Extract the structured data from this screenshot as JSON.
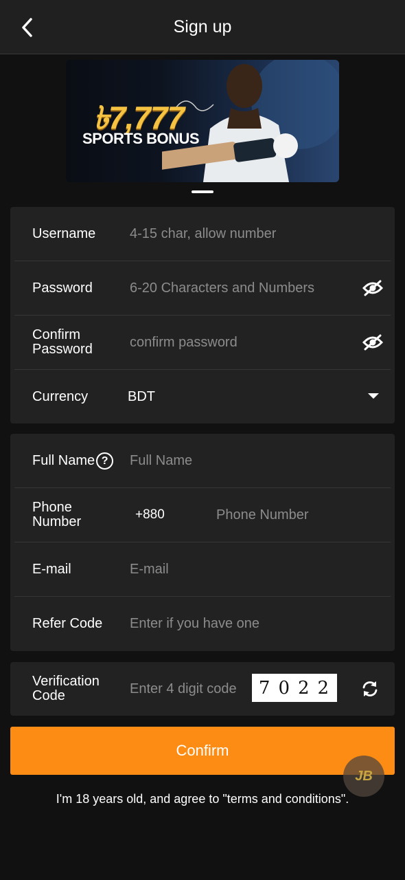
{
  "header": {
    "title": "Sign up",
    "back_icon": "chevron-left-icon"
  },
  "banner": {
    "amount": "৳7,777",
    "subtitle": "SPORTS BONUS",
    "colors": {
      "amount": "#f5c242"
    }
  },
  "account_form": {
    "username": {
      "label": "Username",
      "placeholder": "4-15 char, allow number"
    },
    "password": {
      "label": "Password",
      "placeholder": "6-20 Characters and Numbers",
      "toggle_icon": "eye-off-icon"
    },
    "confirm_password": {
      "label_line1": "Confirm",
      "label_line2": "Password",
      "placeholder": "confirm password",
      "toggle_icon": "eye-off-icon"
    },
    "currency": {
      "label": "Currency",
      "value": "BDT",
      "dropdown_icon": "caret-down-icon"
    }
  },
  "profile_form": {
    "full_name": {
      "label": "Full Name",
      "help_icon": "?",
      "placeholder": "Full Name"
    },
    "phone": {
      "label_line1": "Phone",
      "label_line2": "Number",
      "country_code": "+880",
      "placeholder": "Phone Number"
    },
    "email": {
      "label": "E-mail",
      "placeholder": "E-mail"
    },
    "refer_code": {
      "label": "Refer Code",
      "placeholder": "Enter if you have one"
    }
  },
  "verification": {
    "label_line1": "Verification",
    "label_line2": "Code",
    "placeholder": "Enter 4 digit code",
    "captcha": "7022",
    "refresh_icon": "refresh-icon"
  },
  "actions": {
    "confirm_label": "Confirm"
  },
  "floating_logo": {
    "text": "JB"
  },
  "terms": "I'm 18 years old, and agree to \"terms and conditions\".",
  "colors": {
    "accent": "#fd8c15",
    "background": "#111111",
    "card": "#222222"
  }
}
